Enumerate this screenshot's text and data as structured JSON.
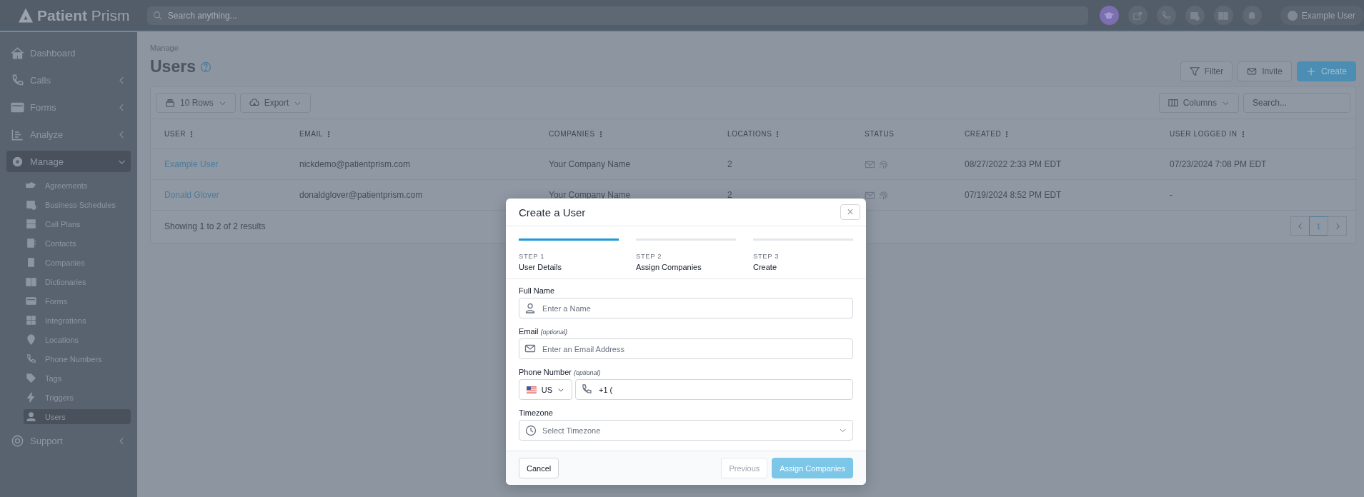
{
  "topbar": {
    "logo": "**Patient** Prism",
    "search_placeholder": "Search anything...",
    "user": "Example User"
  },
  "sidebar": {
    "items": [
      {
        "label": "Dashboard",
        "selected": false
      },
      {
        "label": "Calls",
        "selected": false,
        "expanded": false
      },
      {
        "label": "Forms",
        "selected": false,
        "expanded": false
      },
      {
        "label": "Analyze",
        "selected": false,
        "expanded": false
      },
      {
        "label": "Manage",
        "selected": true,
        "expanded": true,
        "children": [
          {
            "label": "Agreements",
            "selected": false
          },
          {
            "label": "Business Schedules",
            "selected": false
          },
          {
            "label": "Call Plans",
            "selected": false
          },
          {
            "label": "Contacts",
            "selected": false
          },
          {
            "label": "Companies",
            "selected": false
          },
          {
            "label": "Dictionaries",
            "selected": false
          },
          {
            "label": "Forms",
            "selected": false
          },
          {
            "label": "Integrations",
            "selected": false
          },
          {
            "label": "Locations",
            "selected": false
          },
          {
            "label": "Phone Numbers",
            "selected": false
          },
          {
            "label": "Tags",
            "selected": false
          },
          {
            "label": "Triggers",
            "selected": false
          },
          {
            "label": "Users",
            "selected": true
          }
        ]
      },
      {
        "label": "Support",
        "selected": false,
        "expanded": false
      }
    ]
  },
  "page": {
    "breadcrumb": "Manage",
    "title": "Users",
    "actions": [
      {
        "label": "Filter",
        "kind": "filter"
      },
      {
        "label": "Invite",
        "kind": "invite"
      },
      {
        "label": "Create",
        "kind": "primary"
      }
    ]
  },
  "table": {
    "rows_select": "10 Rows",
    "export": "Export",
    "columns_button": "Columns",
    "search_placeholder": "Search...",
    "columns": [
      {
        "label": "USER",
        "menu": true
      },
      {
        "label": "EMAIL",
        "menu": true
      },
      {
        "label": "COMPANIES",
        "menu": true
      },
      {
        "label": "LOCATIONS",
        "menu": true
      },
      {
        "label": "STATUS",
        "menu": false
      },
      {
        "label": "CREATED",
        "menu": true
      },
      {
        "label": "USER LOGGED IN",
        "menu": true
      }
    ],
    "rows": [
      {
        "user": "Example User",
        "email": "nickdemo@patientprism.com",
        "companies": "Your Company Name",
        "locations": "2",
        "created": "08/27/2022 2:33 PM EDT",
        "logged_in": "07/23/2024 7:08 PM EDT"
      },
      {
        "user": "Donald Glover",
        "email": "donaldglover@patientprism.com",
        "companies": "Your Company Name",
        "locations": "2",
        "created": "07/19/2024 8:52 PM EDT",
        "logged_in": "-"
      }
    ],
    "footer": "Showing **1** to **2** of **2** results",
    "pages": [
      {
        "label": "1",
        "selected": true
      }
    ]
  },
  "modal": {
    "title": "Create a User",
    "close": "×",
    "steps": [
      {
        "label": "STEP 1",
        "name": "User Details",
        "selected": true
      },
      {
        "label": "STEP 2",
        "name": "Assign Companies",
        "selected": false
      },
      {
        "label": "STEP 3",
        "name": "Create",
        "selected": false
      }
    ],
    "fields": [
      {
        "kind": "text",
        "label": "Full Name",
        "placeholder": "Enter a Name"
      },
      {
        "kind": "text",
        "label": "Email",
        "note": "(optional)",
        "placeholder": "Enter an Email Address"
      },
      {
        "kind": "phone",
        "label": "Phone Number",
        "note": "(optional)",
        "country": "US",
        "value": "+1 ("
      },
      {
        "kind": "select",
        "label": "Timezone",
        "placeholder": "Select Timezone"
      }
    ],
    "buttons": [
      {
        "label": "Cancel",
        "kind": "secondary",
        "disabled": false
      },
      {
        "label": "Previous",
        "kind": "secondary",
        "disabled": true
      },
      {
        "label": "Assign Companies",
        "kind": "primary",
        "disabled": true
      }
    ]
  }
}
